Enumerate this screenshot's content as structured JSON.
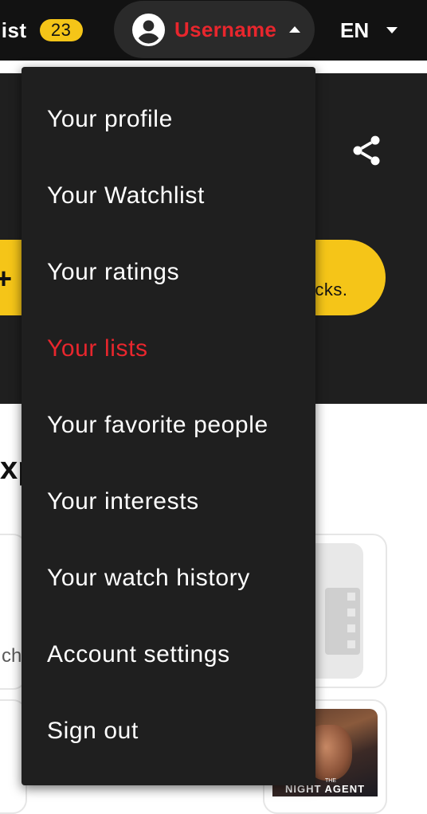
{
  "nav": {
    "watchlist_label": "list",
    "watchlist_count": "23",
    "username": "Username",
    "language": "EN"
  },
  "hero": {
    "pill_text": "icks."
  },
  "content": {
    "section_title": "xp",
    "card_snippet": "chi",
    "poster_title": "NIGHT AGENT",
    "poster_small": "THE"
  },
  "menu": {
    "active_index": 3,
    "items": [
      {
        "label": "Your profile"
      },
      {
        "label": "Your Watchlist"
      },
      {
        "label": "Your ratings"
      },
      {
        "label": "Your lists"
      },
      {
        "label": "Your favorite people"
      },
      {
        "label": "Your interests"
      },
      {
        "label": "Your watch history"
      },
      {
        "label": "Account settings"
      },
      {
        "label": "Sign out"
      }
    ]
  },
  "colors": {
    "accent_red": "#e8262d",
    "accent_yellow": "#f5c518",
    "menu_bg": "#1f1f1f",
    "nav_bg": "#121212"
  },
  "icons": {
    "avatar": "account-circle-icon",
    "user_caret": "caret-up-icon",
    "lang_caret": "caret-down-icon",
    "share": "share-icon",
    "plus": "plus-icon",
    "film": "film-icon"
  }
}
